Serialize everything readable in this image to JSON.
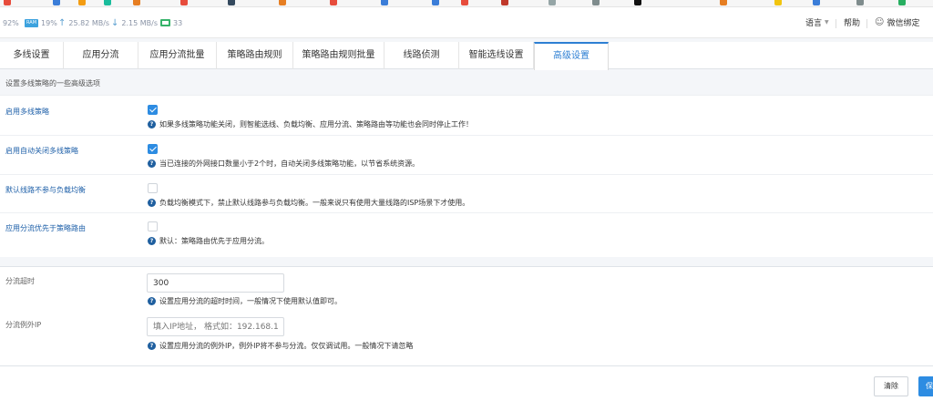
{
  "colors": {
    "accent": "#2d7fd3",
    "label": "#1d5fa8",
    "checkbox_on": "#2d8ce2",
    "hint_icon": "#1f5f9f"
  },
  "status": {
    "cpu": "92%",
    "ram_badge": "RAM",
    "ram": "19%",
    "upload": "25.82 MB/s",
    "download": "2.15 MB/s",
    "devices": "33"
  },
  "header": {
    "language": "语言",
    "help": "帮助",
    "wechat_bind": "微信绑定"
  },
  "tabs": [
    {
      "label": "多线设置",
      "active": false
    },
    {
      "label": "应用分流",
      "active": false
    },
    {
      "label": "应用分流批量",
      "active": false
    },
    {
      "label": "策略路由规则",
      "active": false
    },
    {
      "label": "策略路由规则批量",
      "active": false
    },
    {
      "label": "线路侦测",
      "active": false
    },
    {
      "label": "智能选线设置",
      "active": false
    },
    {
      "label": "高级设置",
      "active": true
    }
  ],
  "page_description": "设置多线策略的一些高级选项",
  "settings": [
    {
      "label": "启用多线策略",
      "checked": true,
      "hint": "如果多线策略功能关闭，则智能选线、负载均衡、应用分流、策略路由等功能也会同时停止工作！"
    },
    {
      "label": "启用自动关闭多线策略",
      "checked": true,
      "hint": "当已连接的外网接口数量小于2个时，自动关闭多线策略功能，以节省系统资源。"
    },
    {
      "label": "默认线路不参与负载均衡",
      "checked": false,
      "hint": "负载均衡模式下，禁止默认线路参与负载均衡。一般来说只有使用大量线路的ISP场景下才使用。"
    },
    {
      "label": "应用分流优先于策略路由",
      "checked": false,
      "hint": "默认：策略路由优先于应用分流。"
    }
  ],
  "timeout": {
    "label": "分流超时",
    "value": "300",
    "hint": "设置应用分流的超时时间，一般情况下使用默认值即可。"
  },
  "exception_ip": {
    "label": "分流例外IP",
    "placeholder": "填入IP地址， 格式如：192.168.1.2",
    "hint": "设置应用分流的例外IP，例外IP将不参与分流。仅仅调试用。一般情况下请忽略"
  },
  "buttons": {
    "clear": "清除",
    "save": "保存"
  }
}
